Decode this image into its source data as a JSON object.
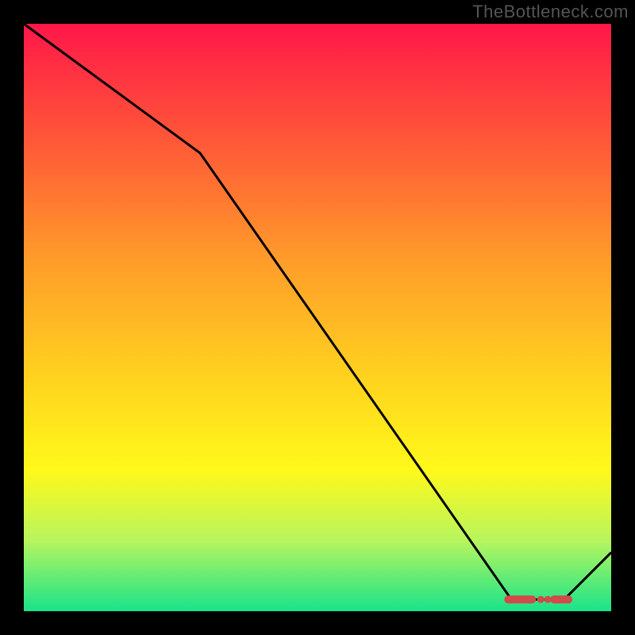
{
  "watermark": "TheBottleneck.com",
  "chart_data": {
    "type": "line",
    "title": "",
    "xlabel": "",
    "ylabel": "",
    "xlim": [
      0,
      100
    ],
    "ylim": [
      0,
      100
    ],
    "grid": false,
    "plot_background": "rainbow-vertical-gradient",
    "gradient_stops": [
      {
        "offset": 0,
        "color": "#ff1749"
      },
      {
        "offset": 20,
        "color": "#ff5838"
      },
      {
        "offset": 40,
        "color": "#ff9b2a"
      },
      {
        "offset": 60,
        "color": "#ffd21f"
      },
      {
        "offset": 76,
        "color": "#fff91a"
      },
      {
        "offset": 88,
        "color": "#b7f55e"
      },
      {
        "offset": 100,
        "color": "#19e38a"
      }
    ],
    "series": [
      {
        "name": "bottleneck-curve",
        "color": "#000000",
        "x": [
          0,
          30,
          83,
          92,
          100
        ],
        "values": [
          100,
          78,
          2,
          2,
          10
        ]
      }
    ],
    "markers": {
      "name": "optimal-range",
      "color": "#d24a49",
      "y": 2,
      "x_start": 82,
      "x_end": 93
    }
  }
}
